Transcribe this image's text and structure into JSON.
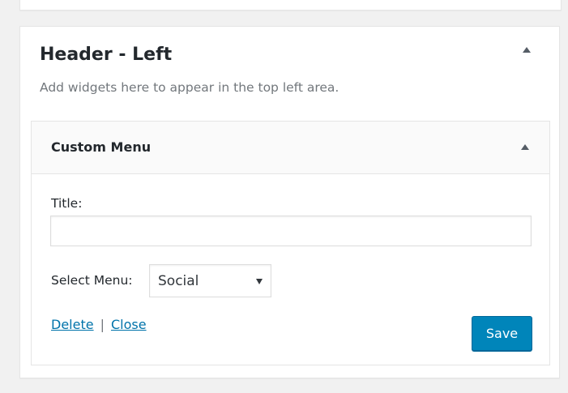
{
  "sidebar": {
    "title": "Header - Left",
    "description": "Add widgets here to appear in the top left area."
  },
  "widget": {
    "title": "Custom Menu",
    "title_field_label": "Title:",
    "title_field_value": "",
    "menu_field_label": "Select Menu:",
    "menu_selected": "Social",
    "delete_label": "Delete",
    "separator": "|",
    "close_label": "Close",
    "save_label": "Save"
  },
  "colors": {
    "primary_button": "#0085ba",
    "link": "#0073aa",
    "background": "#f1f1f1"
  }
}
